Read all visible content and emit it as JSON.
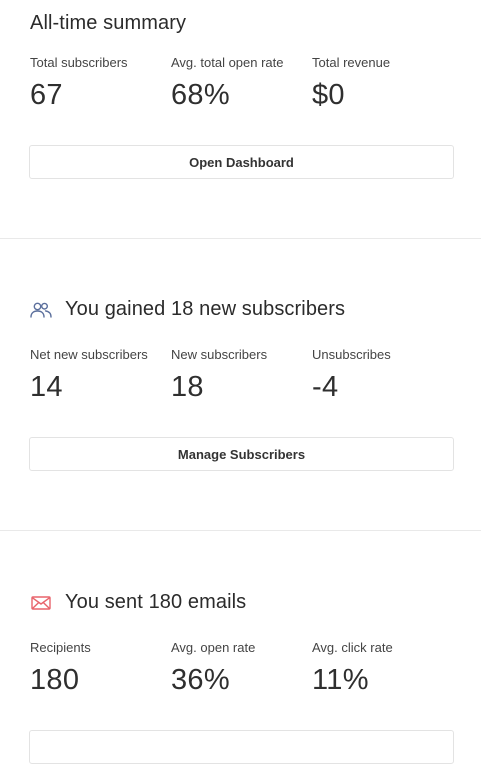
{
  "summary": {
    "title": "All-time summary",
    "stats": [
      {
        "label": "Total subscribers",
        "value": "67"
      },
      {
        "label": "Avg. total open rate",
        "value": "68%"
      },
      {
        "label": "Total revenue",
        "value": "$0"
      }
    ],
    "button_label": "Open Dashboard"
  },
  "subscribers": {
    "title": "You gained 18 new subscribers",
    "icon": "users-icon",
    "icon_color": "#5b6f9c",
    "stats": [
      {
        "label": "Net new subscribers",
        "value": "14"
      },
      {
        "label": "New subscribers",
        "value": "18"
      },
      {
        "label": "Unsubscribes",
        "value": "-4"
      }
    ],
    "button_label": "Manage Subscribers"
  },
  "emails": {
    "title": "You sent 180 emails",
    "icon": "envelope-icon",
    "icon_color": "#e8636b",
    "stats": [
      {
        "label": "Recipients",
        "value": "180"
      },
      {
        "label": "Avg. open rate",
        "value": "36%"
      },
      {
        "label": "Avg. click rate",
        "value": "11%"
      }
    ]
  }
}
